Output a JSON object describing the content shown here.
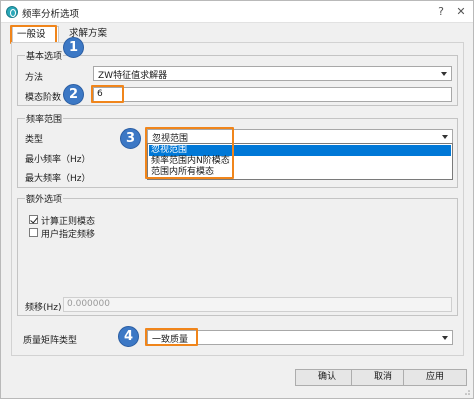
{
  "window": {
    "title": "频率分析选项"
  },
  "tabs": [
    {
      "label": "一般设定"
    },
    {
      "label": "求解方案"
    }
  ],
  "basic": {
    "group_title": "基本选项",
    "method_label": "方法",
    "method_value": "ZW特征值求解器",
    "modes_label": "模态阶数",
    "modes_value": "6"
  },
  "freq": {
    "group_title": "频率范围",
    "type_label": "类型",
    "type_value": "忽视范围",
    "min_label": "最小频率（Hz）",
    "max_label": "最大频率（Hz）",
    "options": [
      "忽视范围",
      "频率范围内N阶模态",
      "范围内所有模态"
    ],
    "selected_index": 0
  },
  "extra": {
    "group_title": "额外选项",
    "check1_label": "计算正则模态",
    "check1_checked": true,
    "check2_label": "用户指定频移",
    "check2_checked": false,
    "shift_label": "频移(Hz)",
    "shift_value": "0.000000"
  },
  "mass": {
    "label": "质量矩阵类型",
    "value": "一致质量"
  },
  "buttons": {
    "ok": "确认",
    "cancel": "取消",
    "apply": "应用"
  },
  "badges": [
    "1",
    "2",
    "3",
    "4"
  ],
  "colors": {
    "highlight": "#f0851b",
    "badge": "#3c78c5",
    "selection": "#0078d7"
  }
}
